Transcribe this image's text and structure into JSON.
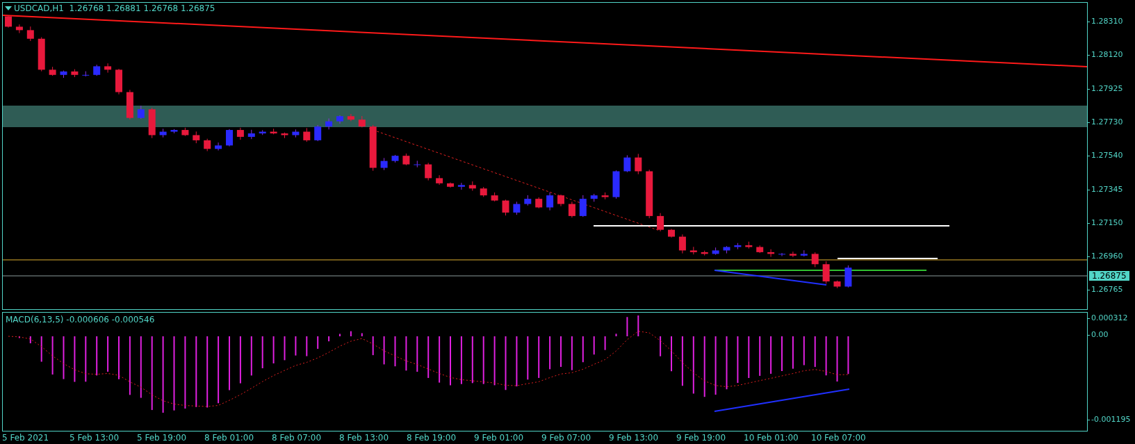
{
  "chart": {
    "title": "USDCAD,H1  1.26768 1.26881 1.26768 1.26875",
    "price_axis": [
      "1.28310",
      "1.28120",
      "1.27925",
      "1.27730",
      "1.27540",
      "1.27345",
      "1.27150",
      "1.26960",
      "1.26765"
    ],
    "current_price": "1.26875"
  },
  "indicator": {
    "label": "MACD(6,13,5) -0.000606 -0.000546",
    "axis": [
      "0.000312",
      "0.00",
      "-0.001195"
    ]
  },
  "time_axis": [
    "5 Feb 2021",
    "5 Feb 13:00",
    "5 Feb 19:00",
    "8 Feb 01:00",
    "8 Feb 07:00",
    "8 Feb 13:00",
    "8 Feb 19:00",
    "9 Feb 01:00",
    "9 Feb 07:00",
    "9 Feb 13:00",
    "9 Feb 19:00",
    "10 Feb 01:00",
    "10 Feb 07:00"
  ]
}
